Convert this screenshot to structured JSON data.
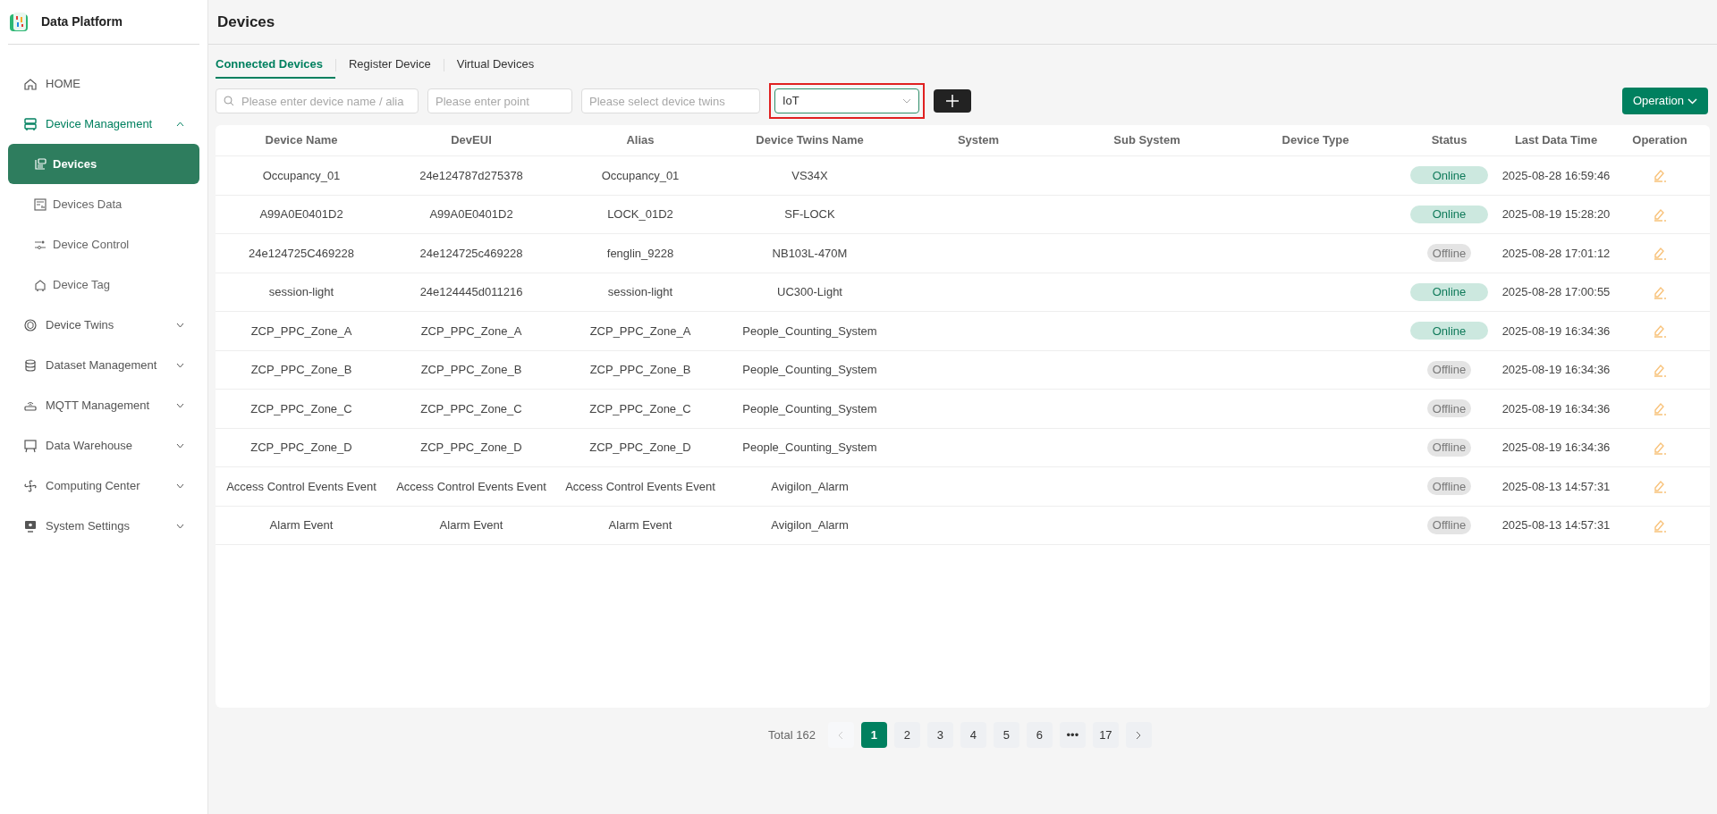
{
  "brand": {
    "name": "Data Platform"
  },
  "sidebar": {
    "items": [
      {
        "label": "HOME"
      },
      {
        "label": "Device Management",
        "expanded": true,
        "children": [
          {
            "label": "Devices",
            "selected": true
          },
          {
            "label": "Devices Data",
            "selected": false
          },
          {
            "label": "Device Control",
            "selected": false
          },
          {
            "label": "Device Tag",
            "selected": false
          }
        ]
      },
      {
        "label": "Device Twins",
        "expanded": false
      },
      {
        "label": "Dataset Management",
        "expanded": false
      },
      {
        "label": "MQTT Management",
        "expanded": false
      },
      {
        "label": "Data Warehouse",
        "expanded": false
      },
      {
        "label": "Computing Center",
        "expanded": false
      },
      {
        "label": "System Settings",
        "expanded": false
      }
    ]
  },
  "page_title": "Devices",
  "tabs": [
    {
      "label": "Connected Devices",
      "selected": true
    },
    {
      "label": "Register Device",
      "selected": false
    },
    {
      "label": "Virtual Devices",
      "selected": false
    }
  ],
  "filters": {
    "search": {
      "placeholder": "Please enter device name / alia"
    },
    "point": {
      "placeholder": "Please enter point"
    },
    "twins": {
      "placeholder": "Please select device twins"
    },
    "category": {
      "value": "IoT"
    }
  },
  "operation_button": "Operation",
  "table": {
    "columns": [
      "Device Name",
      "DevEUI",
      "Alias",
      "Device Twins Name",
      "System",
      "Sub System",
      "Device Type",
      "Status",
      "Last Data Time",
      "Operation"
    ],
    "rows": [
      {
        "device_name": "Occupancy_01",
        "deveui": "24e124787d275378",
        "alias": "Occupancy_01",
        "twins": "VS34X",
        "status": "Online",
        "online": true,
        "last_time": "2025-08-28 16:59:46"
      },
      {
        "device_name": "A99A0E0401D2",
        "deveui": "A99A0E0401D2",
        "alias": "LOCK_01D2",
        "twins": "SF-LOCK",
        "status": "Online",
        "online": true,
        "last_time": "2025-08-19 15:28:20"
      },
      {
        "device_name": "24e124725C469228",
        "deveui": "24e124725c469228",
        "alias": "fenglin_9228",
        "twins": "NB103L-470M",
        "status": "Offline",
        "online": false,
        "last_time": "2025-08-28 17:01:12"
      },
      {
        "device_name": "session-light",
        "deveui": "24e124445d011216",
        "alias": "session-light",
        "twins": "UC300-Light",
        "status": "Online",
        "online": true,
        "last_time": "2025-08-28 17:00:55"
      },
      {
        "device_name": "ZCP_PPC_Zone_A",
        "deveui": "ZCP_PPC_Zone_A",
        "alias": "ZCP_PPC_Zone_A",
        "twins": "People_Counting_System",
        "status": "Online",
        "online": true,
        "last_time": "2025-08-19 16:34:36"
      },
      {
        "device_name": "ZCP_PPC_Zone_B",
        "deveui": "ZCP_PPC_Zone_B",
        "alias": "ZCP_PPC_Zone_B",
        "twins": "People_Counting_System",
        "status": "Offline",
        "online": false,
        "last_time": "2025-08-19 16:34:36"
      },
      {
        "device_name": "ZCP_PPC_Zone_C",
        "deveui": "ZCP_PPC_Zone_C",
        "alias": "ZCP_PPC_Zone_C",
        "twins": "People_Counting_System",
        "status": "Offline",
        "online": false,
        "last_time": "2025-08-19 16:34:36"
      },
      {
        "device_name": "ZCP_PPC_Zone_D",
        "deveui": "ZCP_PPC_Zone_D",
        "alias": "ZCP_PPC_Zone_D",
        "twins": "People_Counting_System",
        "status": "Offline",
        "online": false,
        "last_time": "2025-08-19 16:34:36"
      },
      {
        "device_name": "Access Control Events Event",
        "deveui": "Access Control Events Event",
        "alias": "Access Control Events Event",
        "twins": "Avigilon_Alarm",
        "status": "Offline",
        "online": false,
        "last_time": "2025-08-13 14:57:31"
      },
      {
        "device_name": "Alarm Event",
        "deveui": "Alarm Event",
        "alias": "Alarm Event",
        "twins": "Avigilon_Alarm",
        "status": "Offline",
        "online": false,
        "last_time": "2025-08-13 14:57:31"
      }
    ]
  },
  "pagination": {
    "total": "Total 162",
    "pages": [
      {
        "label": "1",
        "selected": true
      },
      {
        "label": "2",
        "selected": false
      },
      {
        "label": "3",
        "selected": false
      },
      {
        "label": "4",
        "selected": false
      },
      {
        "label": "5",
        "selected": false
      },
      {
        "label": "6",
        "selected": false
      },
      {
        "label": "•••",
        "selected": false
      },
      {
        "label": "17",
        "selected": false
      }
    ]
  }
}
